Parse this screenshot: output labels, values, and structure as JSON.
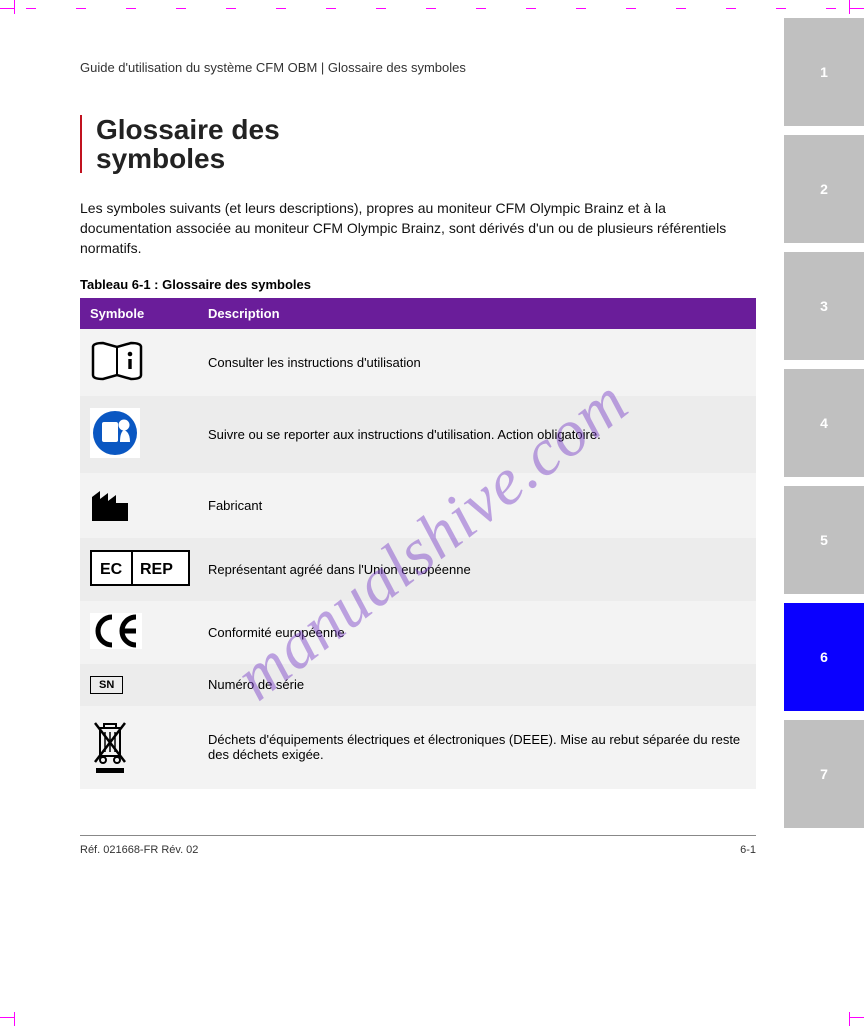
{
  "header": {
    "breadcrumb": "Guide d'utilisation du système CFM OBM | Glossaire des symboles"
  },
  "title": {
    "line1": "Glossaire des",
    "line2": "symboles"
  },
  "intro": "Les symboles suivants (et leurs descriptions), propres au moniteur CFM Olympic Brainz et à la documentation associée au moniteur CFM Olympic Brainz, sont dérivés d'un ou de plusieurs référentiels normatifs.",
  "table": {
    "title": "Tableau 6-1 : Glossaire des symboles",
    "headers": [
      "Symbole",
      "Description"
    ],
    "rows": [
      {
        "description": "Consulter les instructions d'utilisation"
      },
      {
        "description": "Suivre ou se reporter aux instructions d'utilisation. Action obligatoire."
      },
      {
        "description": "Fabricant"
      },
      {
        "description": "Représentant agréé dans l'Union européenne"
      },
      {
        "description": "Conformité européenne"
      },
      {
        "description": "Numéro de série"
      },
      {
        "description": "Déchets d'équipements électriques et électroniques (DEEE). Mise au rebut séparée du reste des déchets exigée."
      }
    ]
  },
  "tabs": [
    "1",
    "2",
    "3",
    "4",
    "5",
    "6",
    "7"
  ],
  "active_tab_index": 5,
  "footer": {
    "part_no": "Réf. 021668-FR Rév. 02",
    "page_no": "6-1"
  },
  "sn_label": "SN",
  "watermark": "manualshive.com"
}
